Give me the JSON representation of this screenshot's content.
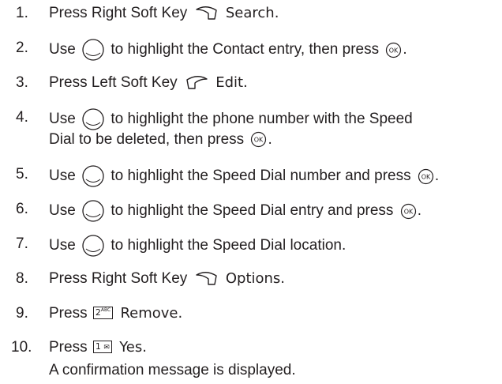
{
  "steps": [
    {
      "num": "1.",
      "before": "Press Right Soft Key",
      "icon": "right-soft-key-icon",
      "after": "Search."
    },
    {
      "num": "2.",
      "before": "Use",
      "icon": "nav-key-icon",
      "mid": "to highlight the Contact entry, then press",
      "icon2": "ok-key-icon",
      "after": "."
    },
    {
      "num": "3.",
      "before": "Press Left Soft Key",
      "icon": "left-soft-key-icon",
      "after": "Edit."
    },
    {
      "num": "4.",
      "before": "Use",
      "icon": "nav-key-icon",
      "mid": "to highlight the phone number with the Speed",
      "line2": "Dial to be deleted, then press",
      "icon2": "ok-key-icon",
      "after": "."
    },
    {
      "num": "5.",
      "before": "Use",
      "icon": "nav-key-icon",
      "mid": "to highlight the Speed Dial number and press",
      "icon2": "ok-key-icon",
      "after": "."
    },
    {
      "num": "6.",
      "before": "Use",
      "icon": "nav-key-icon",
      "mid": "to highlight the Speed Dial entry and press",
      "icon2": "ok-key-icon",
      "after": "."
    },
    {
      "num": "7.",
      "before": "Use",
      "icon": "nav-key-icon",
      "mid": "to highlight the Speed Dial location."
    },
    {
      "num": "8.",
      "before": "Press Right Soft Key",
      "icon": "right-soft-key-icon",
      "after": "Options."
    },
    {
      "num": "9.",
      "before": "Press",
      "key": {
        "main": "2",
        "sup": "ABC"
      },
      "after": "Remove."
    },
    {
      "num": "10.",
      "before": "Press",
      "key": {
        "main": "1",
        "sup": "✉"
      },
      "after": "Yes.",
      "line2": "A confirmation message is displayed."
    }
  ],
  "ok_label": "OK"
}
